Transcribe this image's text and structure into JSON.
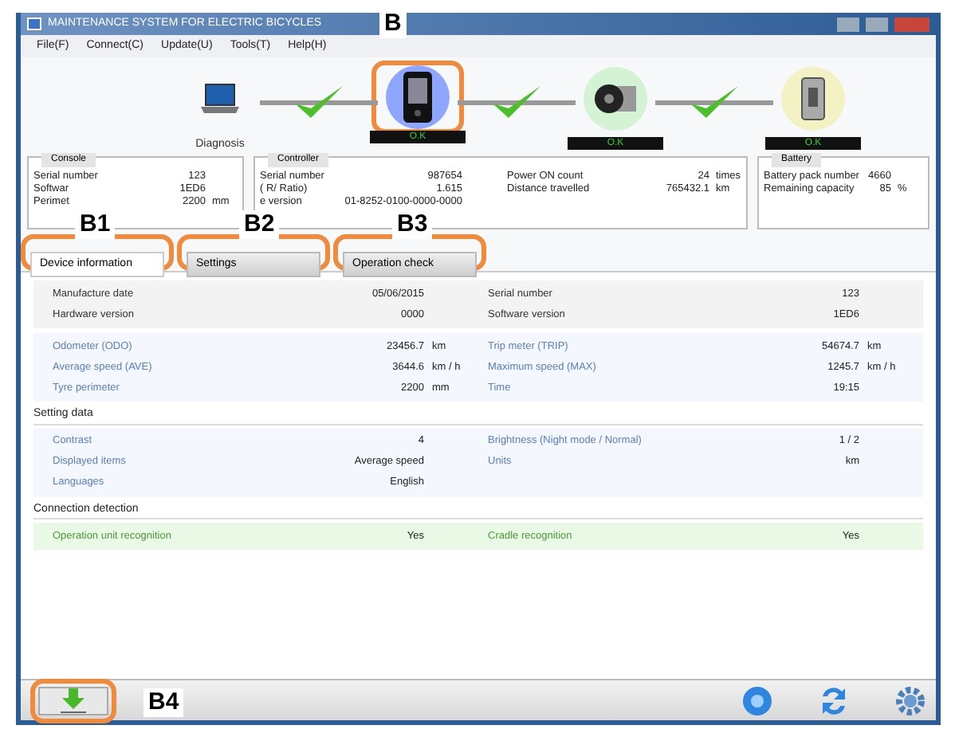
{
  "window": {
    "title": "MAINTENANCE SYSTEM FOR ELECTRIC BICYCLES"
  },
  "menu": [
    "File(F)",
    "Connect(C)",
    "Update(U)",
    "Tools(T)",
    "Help(H)"
  ],
  "diagnosis": {
    "label": "Diagnosis",
    "devices": [
      {
        "kind": "pc",
        "selected": false
      },
      {
        "kind": "console",
        "status": "O.K",
        "selected": true,
        "connected": true
      },
      {
        "kind": "drive",
        "status": "O.K",
        "selected": false,
        "connected": true
      },
      {
        "kind": "battery",
        "status": "O.K",
        "selected": false,
        "connected": true
      }
    ]
  },
  "info_panels": [
    {
      "title": "Console",
      "rows": [
        {
          "label": "Serial number",
          "value": "123"
        },
        {
          "label": "Softwar",
          "value": "1ED6"
        },
        {
          "label": "Perimet",
          "value": "2200",
          "unit": "mm"
        }
      ]
    },
    {
      "title": "Controller",
      "rows": [
        {
          "label": "Serial number",
          "value": "987654"
        },
        {
          "label": "( R/ Ratio)",
          "value": "1.615"
        },
        {
          "label": "e version",
          "value": "01-8252-0100-0000-0000"
        }
      ],
      "rows_2": [
        {
          "label": "Power ON count",
          "value": "24",
          "unit": "times"
        },
        {
          "label": "Distance travelled",
          "value": "765432.1",
          "unit": "km"
        }
      ]
    },
    {
      "title": "Battery",
      "rows": [
        {
          "label": "Battery pack number",
          "value": "4660"
        },
        {
          "label": "Remaining capacity",
          "value": "85",
          "unit": "%"
        }
      ]
    }
  ],
  "tabs": [
    {
      "label": "Device information",
      "selected": true
    },
    {
      "label": "Settings",
      "selected": false
    },
    {
      "label": "Operation check",
      "selected": false
    }
  ],
  "sections": [
    {
      "kind": "plain",
      "items": [
        {
          "label": "Manufacture date",
          "value": "05/06/2015"
        },
        {
          "label": "Serial number",
          "value": "123"
        },
        {
          "label": "Hardware version",
          "value": "0000"
        },
        {
          "label": "Software version",
          "value": "1ED6"
        }
      ]
    },
    {
      "kind": "blue",
      "items": [
        {
          "label": "Odometer (ODO)",
          "value": "23456.7",
          "unit": "km"
        },
        {
          "label": "Trip meter (TRIP)",
          "value": "54674.7",
          "unit": "km"
        },
        {
          "label": "Average speed (AVE)",
          "value": "3644.6",
          "unit": "km / h"
        },
        {
          "label": "Maximum speed (MAX)",
          "value": "1245.7",
          "unit": "km / h"
        },
        {
          "label": "Tyre perimeter",
          "value": "2200",
          "unit": "mm"
        },
        {
          "label": "Time",
          "value": "19:15"
        }
      ]
    },
    {
      "kind": "blue",
      "title": "Setting data",
      "items": [
        {
          "label": "Contrast",
          "value": "4"
        },
        {
          "label": "Brightness (Night mode / Normal)",
          "value": "1 / 2"
        },
        {
          "label": "Displayed items",
          "value": "Average speed"
        },
        {
          "label": "Units",
          "value": "km"
        },
        {
          "label": "Languages",
          "value": "English"
        }
      ]
    },
    {
      "kind": "green",
      "title": "Connection detection",
      "items": [
        {
          "label": "Operation unit recognition",
          "value": "Yes"
        },
        {
          "label": "Cradle recognition",
          "value": "Yes"
        }
      ]
    }
  ],
  "callouts": [
    "B",
    "B1",
    "B2",
    "B3",
    "B4"
  ]
}
